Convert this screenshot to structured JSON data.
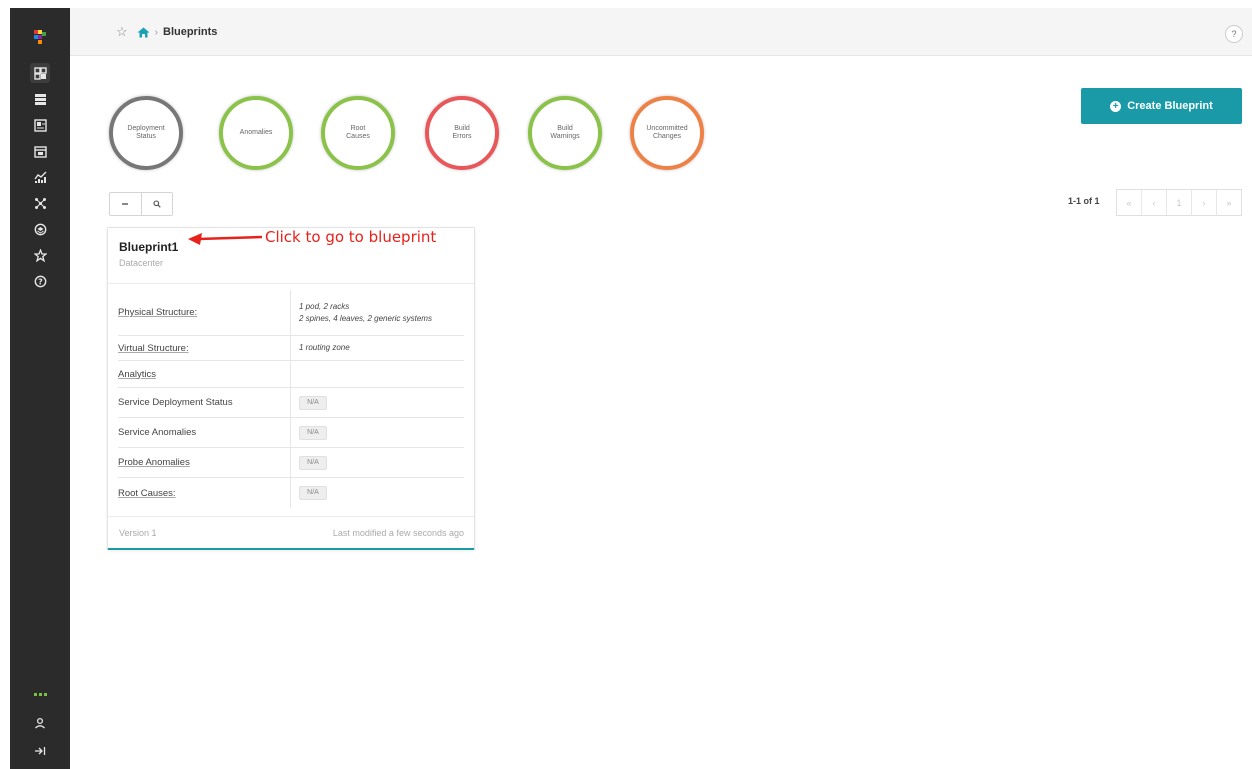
{
  "breadcrumb": {
    "current": "Blueprints"
  },
  "help": {
    "label": "?"
  },
  "gauges": [
    {
      "label": "Deployment Status",
      "color": "#777777"
    },
    {
      "label": "Anomalies",
      "color": "#8bc34a"
    },
    {
      "label": "Root Causes",
      "color": "#8bc34a"
    },
    {
      "label": "Build Errors",
      "color": "#e8575a"
    },
    {
      "label": "Build Warnings",
      "color": "#8bc34a"
    },
    {
      "label": "Uncommitted Changes",
      "color": "#ee8145"
    }
  ],
  "create_button": {
    "label": "Create Blueprint",
    "color": "#1a9aa7"
  },
  "pagination": {
    "summary": "1-1 of 1",
    "buttons": [
      "«",
      "‹",
      "1",
      "›",
      "»"
    ]
  },
  "card": {
    "title": "Blueprint1",
    "subtitle": "Datacenter",
    "rows": [
      {
        "key": "Physical Structure:",
        "values": [
          "1 pod, 2 racks",
          "2 spines, 4 leaves, 2 generic systems"
        ]
      },
      {
        "key": "Virtual Structure:",
        "values": [
          "1 routing zone"
        ]
      },
      {
        "key": "Analytics",
        "values": []
      },
      {
        "key": "Service Deployment Status",
        "badge": "N/A"
      },
      {
        "key": "Service Anomalies",
        "badge": "N/A"
      },
      {
        "key": "Probe Anomalies",
        "badge": "N/A"
      },
      {
        "key": "Root Causes:",
        "badge": "N/A"
      }
    ],
    "version": "Version 1",
    "modified": "Last modified a few seconds ago"
  },
  "annotation": {
    "text": "Click to go to blueprint",
    "color": "#e8211a"
  }
}
